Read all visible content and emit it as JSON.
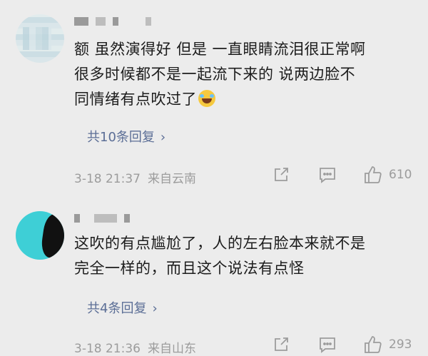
{
  "comments": [
    {
      "text_lines": [
        "额 虽然演得好 但是 一直眼睛流泪很正常啊",
        "很多时候都不是一起流下来的 说两边脸不",
        "同情绪有点吹过了"
      ],
      "replies_label": "共10条回复",
      "date": "3-18 21:37",
      "location": "来自云南",
      "like_count": "610"
    },
    {
      "text_lines": [
        "这吹的有点尴尬了，人的左右脸本来就不是",
        "完全一样的，而且这个说法有点怪"
      ],
      "replies_label": "共4条回复",
      "date": "3-18 21:36",
      "location": "来自山东",
      "like_count": "293"
    }
  ],
  "icons": {
    "reply_arrow": "chevron-right-icon",
    "share": "share-icon",
    "comment": "comment-icon",
    "like": "thumbs-up-icon"
  },
  "colors": {
    "background": "#ececec",
    "text": "#1c1c1c",
    "link": "#5b6e96",
    "meta": "#9c9c9c"
  }
}
